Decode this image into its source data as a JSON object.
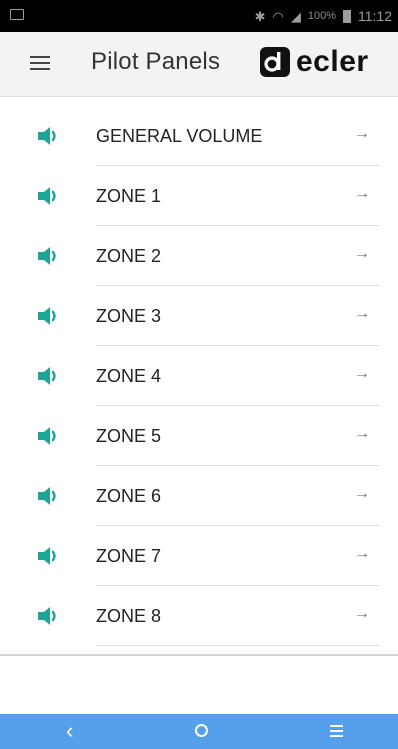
{
  "status_bar": {
    "battery": "100%",
    "time": "11:12",
    "icons": [
      "image-notification-icon",
      "bluetooth-icon",
      "wifi-icon",
      "signal-icon",
      "battery-icon"
    ]
  },
  "header": {
    "title": "Pilot Panels",
    "logo_text": "ecler",
    "menu_icon": "hamburger-menu-icon"
  },
  "list": {
    "accent_color": "#1aa793",
    "items": [
      {
        "label": "GENERAL VOLUME",
        "icon": "speaker-icon",
        "arrow": "→"
      },
      {
        "label": "ZONE 1",
        "icon": "speaker-icon",
        "arrow": "→"
      },
      {
        "label": "ZONE 2",
        "icon": "speaker-icon",
        "arrow": "→"
      },
      {
        "label": "ZONE 3",
        "icon": "speaker-icon",
        "arrow": "→"
      },
      {
        "label": "ZONE 4",
        "icon": "speaker-icon",
        "arrow": "→"
      },
      {
        "label": "ZONE 5",
        "icon": "speaker-icon",
        "arrow": "→"
      },
      {
        "label": "ZONE 6",
        "icon": "speaker-icon",
        "arrow": "→"
      },
      {
        "label": "ZONE 7",
        "icon": "speaker-icon",
        "arrow": "→"
      },
      {
        "label": "ZONE 8",
        "icon": "speaker-icon",
        "arrow": "→"
      }
    ]
  },
  "navbar": {
    "color": "#56a0eb",
    "back_glyph": "‹",
    "items": [
      "back-icon",
      "home-icon",
      "recent-apps-icon"
    ]
  }
}
